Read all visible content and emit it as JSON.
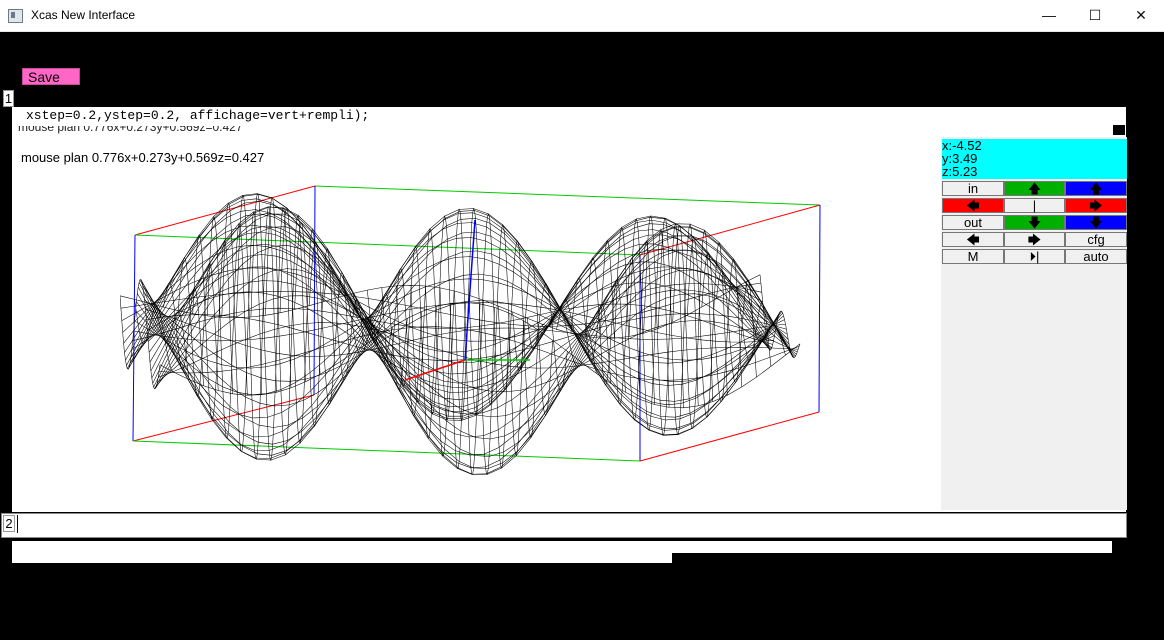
{
  "window": {
    "title": "Xcas New Interface",
    "minimize": "—",
    "maximize": "☐",
    "close": "✕"
  },
  "toolbar": {
    "save_label": "Save"
  },
  "entries": {
    "first_number": "1",
    "second_number": "2"
  },
  "command": {
    "text": "xstep=0.2,ystep=0.2, affichage=vert+rempli);"
  },
  "plot": {
    "clipped_status": "mouse plan 0.776x+0.273y+0.569z=0.427",
    "mouse_plan": "mouse plan 0.776x+0.273y+0.569z=0.427",
    "colors": {
      "surface": "#000000",
      "x_axis": "#ff0000",
      "y_axis": "#00cc00",
      "z_axis": "#0000ff"
    }
  },
  "controls": {
    "x": "x:-4.52",
    "y": "y:3.49",
    "z": "z:5.23",
    "in": "in",
    "out": "out",
    "pipe": "|",
    "cfg": "cfg",
    "m": "M",
    "auto": "auto",
    "up_arrow": "🡅",
    "down_arrow": "🡇",
    "left_arrow": "🡄",
    "right_arrow": "🡆",
    "play_icon": "⏵|",
    "colors": {
      "green": "#00b000",
      "blue": "#0000ff",
      "red": "#ff0000",
      "cyan": "#00ffff"
    }
  }
}
